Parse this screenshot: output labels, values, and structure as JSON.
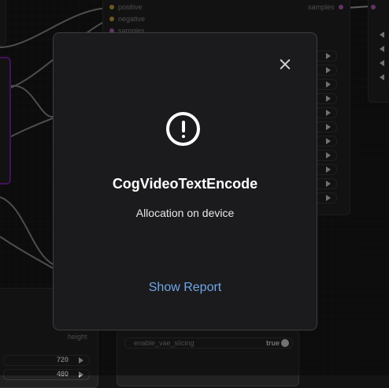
{
  "background": {
    "inputs": [
      "positive",
      "negative",
      "samples"
    ],
    "output_label": "samples",
    "height_label": "height",
    "widget_values": [
      "720",
      "480"
    ],
    "vae_slicing": {
      "label": "enable_vae_slicing",
      "value": "true"
    },
    "colors": {
      "positive": "#c9a23c",
      "negative": "#c9a23c",
      "samples": "#b35fb3",
      "purple_node": "#7b1fa2"
    }
  },
  "dialog": {
    "title": "CogVideoTextEncode",
    "message": "Allocation on device",
    "report_label": "Show Report",
    "icon": "exclamation-circle-icon",
    "close_icon": "close-icon",
    "colors": {
      "background": "#1b1b1d",
      "link": "#6ea6e8"
    }
  }
}
